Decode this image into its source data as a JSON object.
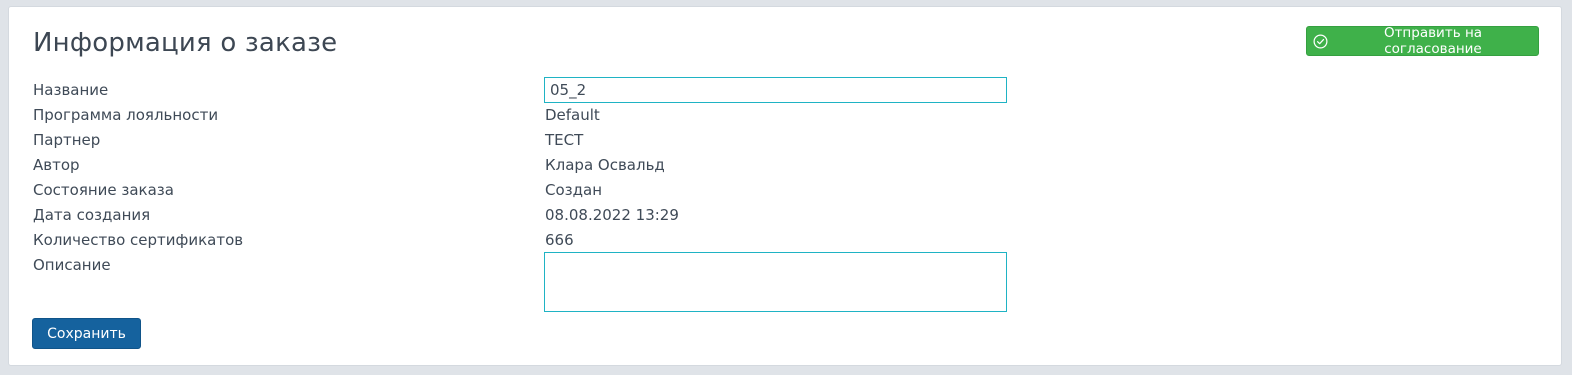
{
  "colors": {
    "approve_button": "#3fb14a",
    "save_button": "#15629e",
    "input_border": "#1fb3c4",
    "text": "#3f4a57"
  },
  "header": {
    "title": "Информация о заказе",
    "approve_button": {
      "icon": "check-circle-icon",
      "label": "Отправить на согласование"
    }
  },
  "fields": {
    "name": {
      "label": "Название",
      "value": "05_2"
    },
    "loyalty_program": {
      "label": "Программа лояльности",
      "value": "Default"
    },
    "partner": {
      "label": "Партнер",
      "value": "ТЕСТ"
    },
    "author": {
      "label": "Автор",
      "value": "Клара Освальд"
    },
    "status": {
      "label": "Состояние заказа",
      "value": "Создан"
    },
    "created_date": {
      "label": "Дата создания",
      "value": "08.08.2022 13:29"
    },
    "certificate_count": {
      "label": "Количество сертификатов",
      "value": "666"
    },
    "description": {
      "label": "Описание",
      "value": ""
    }
  },
  "footer": {
    "save_label": "Сохранить"
  }
}
